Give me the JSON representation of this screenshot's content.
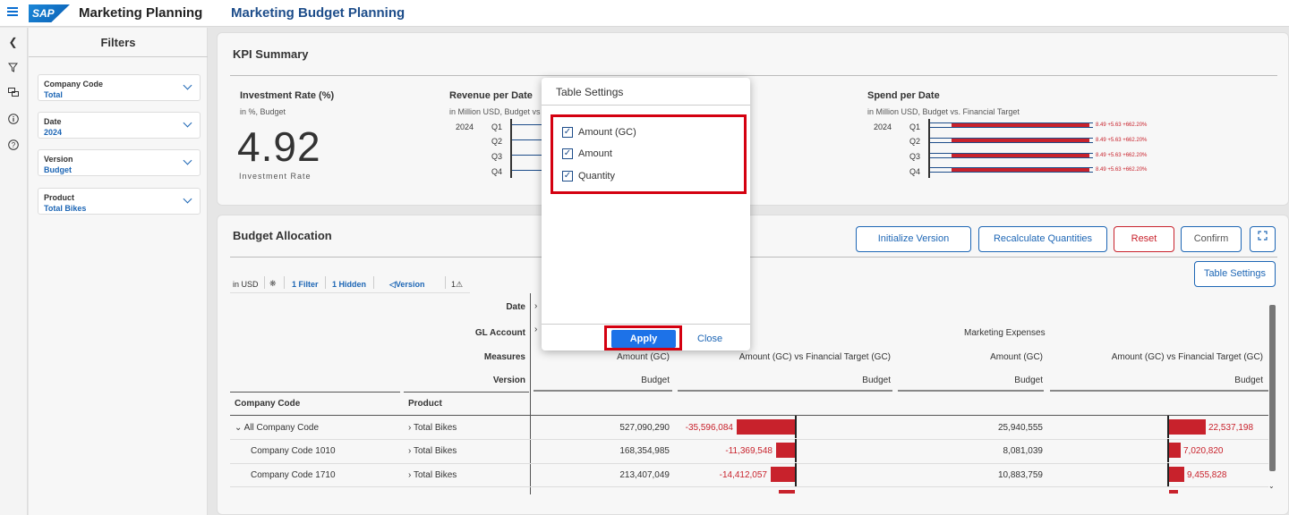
{
  "header": {
    "logo_text": "SAP",
    "app_title": "Marketing Planning",
    "page_title": "Marketing Budget Planning"
  },
  "filters": {
    "title": "Filters",
    "items": [
      {
        "label": "Company Code",
        "value": "Total"
      },
      {
        "label": "Date",
        "value": "2024"
      },
      {
        "label": "Version",
        "value": "Budget"
      },
      {
        "label": "Product",
        "value": "Total Bikes"
      }
    ]
  },
  "kpi": {
    "title": "KPI Summary",
    "investment": {
      "title": "Investment Rate (%)",
      "subtitle": "in %, Budget",
      "value": "4.92",
      "caption": "Investment Rate"
    },
    "revenue": {
      "title": "Revenue per Date",
      "subtitle": "in Million USD, Budget vs",
      "year": "2024",
      "quarters": [
        "Q1",
        "Q2",
        "Q3",
        "Q4"
      ]
    },
    "spend": {
      "title": "Spend per Date",
      "subtitle": "in Million USD, Budget vs. Financial Target",
      "year": "2024",
      "quarters": [
        "Q1",
        "Q2",
        "Q3",
        "Q4"
      ],
      "bar_label": "8.49 +5.63 +662.20%"
    }
  },
  "budget": {
    "title": "Budget Allocation",
    "buttons": {
      "init": "Initialize Version",
      "recalc": "Recalculate Quantities",
      "reset": "Reset",
      "confirm": "Confirm",
      "table_settings": "Table Settings"
    },
    "toolbar": {
      "currency": "in USD",
      "filter": "1 Filter",
      "hidden": "1 Hidden",
      "version": "Version",
      "warn": "1"
    },
    "dims": {
      "date": "Date",
      "gl": "GL Account",
      "measures": "Measures",
      "version": "Version",
      "company": "Company Code",
      "product": "Product"
    },
    "col_headers": {
      "gl2": "Marketing Expenses",
      "m1": "Amount (GC)",
      "m2": "Amount (GC) vs Financial Target (GC)",
      "m3": "Amount (GC)",
      "m4": "Amount (GC) vs Financial Target (GC)",
      "version": "Budget"
    },
    "rows": [
      {
        "company": "All Company Code",
        "product": "Total Bikes",
        "v1": "527,090,290",
        "v2": "-35,596,084",
        "v3": "25,940,555",
        "v4": "22,537,198"
      },
      {
        "company": "Company Code 1010",
        "product": "Total Bikes",
        "v1": "168,354,985",
        "v2": "-11,369,548",
        "v3": "8,081,039",
        "v4": "7,020,820"
      },
      {
        "company": "Company Code 1710",
        "product": "Total Bikes",
        "v1": "213,407,049",
        "v2": "-14,412,057",
        "v3": "10,883,759",
        "v4": "9,455,828"
      }
    ]
  },
  "dialog": {
    "title": "Table Settings",
    "options": [
      "Amount (GC)",
      "Amount",
      "Quantity"
    ],
    "apply": "Apply",
    "close": "Close"
  },
  "colors": {
    "accent": "#1d66b5",
    "negative": "#c8222c",
    "highlight": "#d40010"
  }
}
